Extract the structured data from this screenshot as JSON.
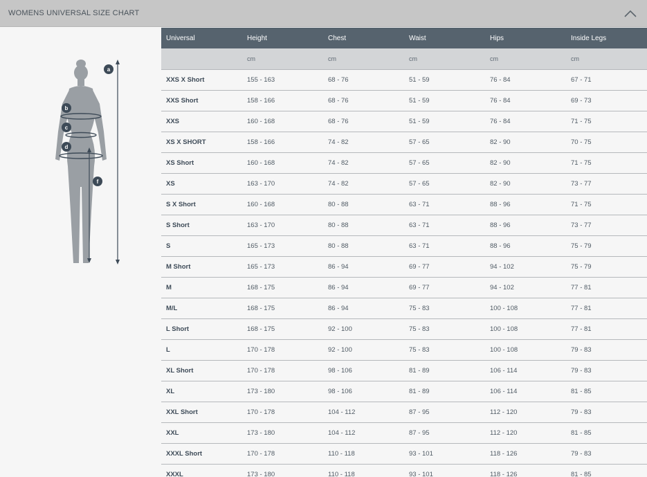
{
  "header": {
    "title": "WOMENS UNIVERSAL SIZE CHART"
  },
  "icons": {
    "collapse": "chevron-up-icon"
  },
  "figure": {
    "labels": [
      "a",
      "b",
      "c",
      "d",
      "f"
    ]
  },
  "table": {
    "columns": [
      "Universal",
      "Height",
      "Chest",
      "Waist",
      "Hips",
      "Inside Legs"
    ],
    "units": [
      "",
      "cm",
      "cm",
      "cm",
      "cm",
      "cm"
    ],
    "rows": [
      [
        "XXS X Short",
        "155 - 163",
        "68 - 76",
        "51 - 59",
        "76 - 84",
        "67 - 71"
      ],
      [
        "XXS Short",
        "158 - 166",
        "68 - 76",
        "51 - 59",
        "76 - 84",
        "69 - 73"
      ],
      [
        "XXS",
        "160 - 168",
        "68 - 76",
        "51 - 59",
        "76 - 84",
        "71 - 75"
      ],
      [
        "XS X SHORT",
        "158 - 166",
        "74 - 82",
        "57 - 65",
        "82 - 90",
        "70 - 75"
      ],
      [
        "XS Short",
        "160 - 168",
        "74 - 82",
        "57 - 65",
        "82 - 90",
        "71 - 75"
      ],
      [
        "XS",
        "163 - 170",
        "74 - 82",
        "57 - 65",
        "82 - 90",
        "73 - 77"
      ],
      [
        "S X Short",
        "160 - 168",
        "80 - 88",
        "63 - 71",
        "88 - 96",
        "71 - 75"
      ],
      [
        "S Short",
        "163 - 170",
        "80 - 88",
        "63 - 71",
        "88 - 96",
        "73 - 77"
      ],
      [
        "S",
        "165 - 173",
        "80 - 88",
        "63 - 71",
        "88 - 96",
        "75 - 79"
      ],
      [
        "M Short",
        "165 - 173",
        "86 - 94",
        "69 - 77",
        "94 - 102",
        "75 - 79"
      ],
      [
        "M",
        "168 - 175",
        "86 - 94",
        "69 - 77",
        "94 - 102",
        "77 - 81"
      ],
      [
        "M/L",
        "168 - 175",
        "86 - 94",
        "75 - 83",
        "100 - 108",
        "77 - 81"
      ],
      [
        "L Short",
        "168 - 175",
        "92 - 100",
        "75 - 83",
        "100 - 108",
        "77 - 81"
      ],
      [
        "L",
        "170 - 178",
        "92 - 100",
        "75 - 83",
        "100 - 108",
        "79 - 83"
      ],
      [
        "XL Short",
        "170 - 178",
        "98 - 106",
        "81 - 89",
        "106 - 114",
        "79 - 83"
      ],
      [
        "XL",
        "173 - 180",
        "98 - 106",
        "81 - 89",
        "106 - 114",
        "81 - 85"
      ],
      [
        "XXL Short",
        "170 - 178",
        "104 - 112",
        "87 - 95",
        "112 - 120",
        "79 - 83"
      ],
      [
        "XXL",
        "173 - 180",
        "104 - 112",
        "87 - 95",
        "112 - 120",
        "81 - 85"
      ],
      [
        "XXXL Short",
        "170 - 178",
        "110 - 118",
        "93 - 101",
        "118 - 126",
        "79 - 83"
      ],
      [
        "XXXL",
        "173 - 180",
        "110 - 118",
        "93 - 101",
        "118 - 126",
        "81 - 85"
      ]
    ]
  }
}
